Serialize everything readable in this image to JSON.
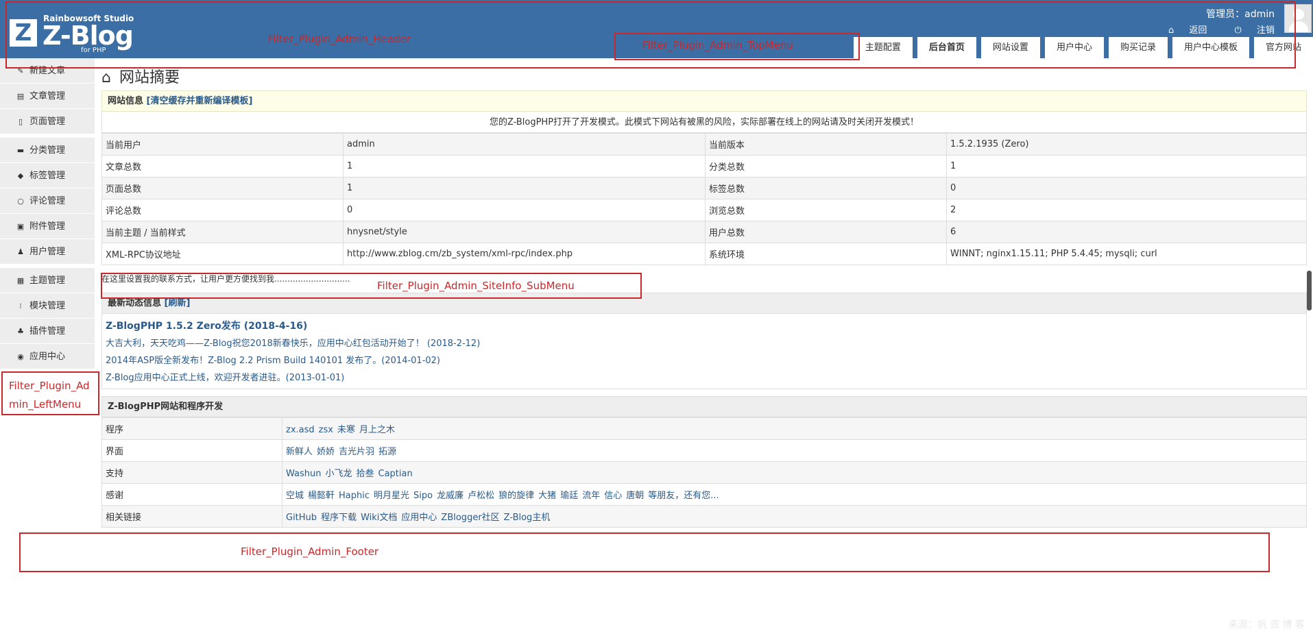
{
  "header": {
    "studio": "Rainbowsoft Studio",
    "brand": "Z-Blog",
    "for_php": "for PHP",
    "logo_mark": "Z",
    "admin_label": "管理员：admin",
    "back_label": "返回",
    "logout_label": "注销",
    "back_icon": "home-icon",
    "logout_icon": "power-icon"
  },
  "topmenu": {
    "tabs": [
      "主题配置",
      "后台首页",
      "网站设置",
      "用户中心",
      "购买记录",
      "用户中心模板",
      "官方网站"
    ],
    "active": "后台首页"
  },
  "leftmenu": {
    "items": [
      {
        "label": "新建文章",
        "icon": "edit-icon"
      },
      {
        "label": "文章管理",
        "icon": "article-icon"
      },
      {
        "label": "页面管理",
        "icon": "page-icon"
      },
      {
        "label": "分类管理",
        "icon": "folder-icon"
      },
      {
        "label": "标签管理",
        "icon": "tag-icon"
      },
      {
        "label": "评论管理",
        "icon": "comment-icon"
      },
      {
        "label": "附件管理",
        "icon": "attachment-icon"
      },
      {
        "label": "用户管理",
        "icon": "user-icon"
      },
      {
        "label": "主题管理",
        "icon": "theme-icon"
      },
      {
        "label": "模块管理",
        "icon": "module-icon"
      },
      {
        "label": "插件管理",
        "icon": "plugin-icon"
      },
      {
        "label": "应用中心",
        "icon": "app-center-icon"
      }
    ]
  },
  "main": {
    "title": "网站摘要",
    "site_info_head": "网站信息",
    "site_info_action": "[清空缓存并重新编译模板]",
    "dev_notice": "您的Z-BlogPHP打开了开发模式。此模式下网站有被黑的风险，实际部署在线上的网站请及时关闭开发模式！",
    "info_rows": [
      [
        "当前用户",
        "admin",
        "当前版本",
        "1.5.2.1935 (Zero)"
      ],
      [
        "文章总数",
        "1",
        "分类总数",
        "1"
      ],
      [
        "页面总数",
        "1",
        "标签总数",
        "0"
      ],
      [
        "评论总数",
        "0",
        "浏览总数",
        "2"
      ],
      [
        "当前主题 / 当前样式",
        "hnysnet/style",
        "用户总数",
        "6"
      ],
      [
        "XML-RPC协议地址",
        "http://www.zblog.cm/zb_system/xml-rpc/index.php",
        "系统环境",
        "WINNT; nginx1.15.11; PHP 5.4.45; mysqli; curl"
      ]
    ],
    "contact_text": "在这里设置我的联系方式，让用户更方便找到我.............................",
    "news_head": "最新动态信息",
    "news_action": "[刷新]",
    "news": [
      "Z-BlogPHP 1.5.2 Zero发布 (2018-4-16)",
      "大吉大利，天天吃鸡——Z-Blog祝您2018新春快乐，应用中心红包活动开始了！ (2018-2-12)",
      "2014年ASP版全新发布！Z-Blog 2.2 Prism Build 140101 发布了。(2014-01-02)",
      "Z-Blog应用中心正式上线，欢迎开发者进驻。(2013-01-01)"
    ],
    "dev_head": "Z-BlogPHP网站和程序开发",
    "dev_rows": [
      {
        "k": "程序",
        "v": [
          "zx.asd",
          "zsx",
          "未寒",
          "月上之木"
        ]
      },
      {
        "k": "界面",
        "v": [
          "新鲜人",
          "娇娇",
          "吉光片羽",
          "拓源"
        ]
      },
      {
        "k": "支持",
        "v": [
          "Washun",
          "小飞龙",
          "拾叁",
          "Captian"
        ]
      },
      {
        "k": "感谢",
        "v": [
          "空城",
          "楊懿軒",
          "Haphic",
          "明月星光",
          "Sipo",
          "龙威廉",
          "卢松松",
          "狼的旋律",
          "大猪",
          "瑜廷",
          "流年",
          "信心",
          "唐朝",
          "等朋友，还有您..."
        ]
      },
      {
        "k": "相关链接",
        "v": [
          "GitHub",
          "程序下载",
          "Wiki文档",
          "应用中心",
          "ZBlogger社区",
          "Z-Blog主机"
        ]
      }
    ]
  },
  "annotations": {
    "header": "Filter_Plugin_Admin_Header",
    "topmenu": "Filter_Plugin_Admin_TopMenu",
    "siteinfo_submenu": "Filter_Plugin_Admin_SiteInfo_SubMenu",
    "leftmenu": "Filter_Plugin_Ad min_LeftMenu",
    "footer": "Filter_Plugin_Admin_Footer",
    "color": "#c8282a"
  },
  "watermark": "来源：帆 资 博 客",
  "colors": {
    "header_bg": "#3a6ea5",
    "link": "#2a5a8a",
    "notice_bg": "#fdfde8"
  }
}
